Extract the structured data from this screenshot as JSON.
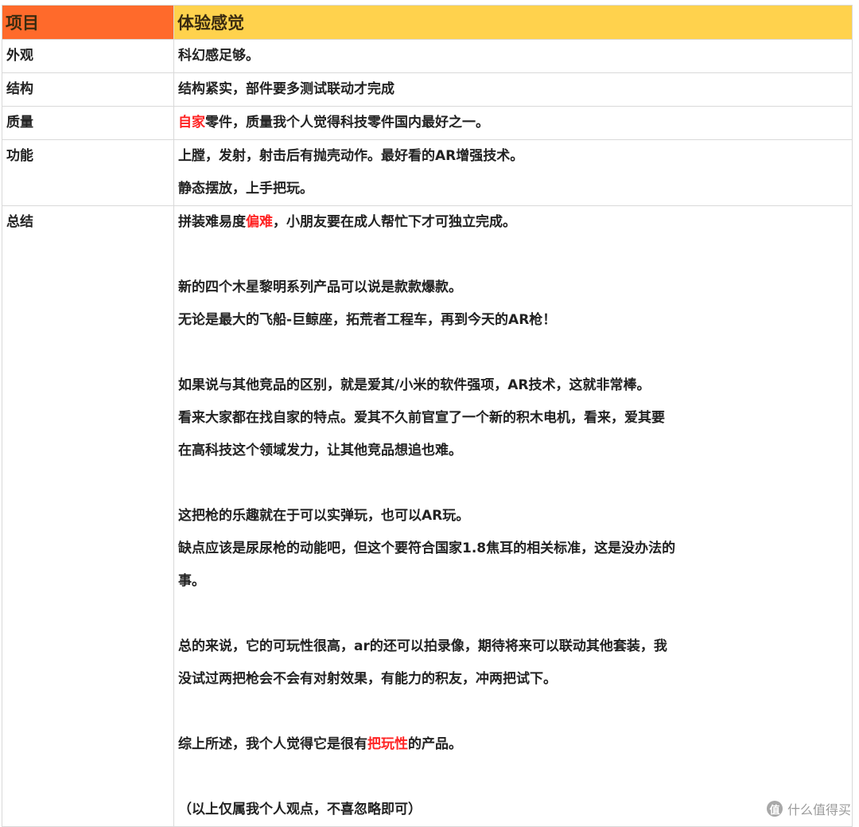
{
  "header": {
    "col1": "项目",
    "col2": "体验感觉",
    "col1_color": "#ff6a2b",
    "col2_color": "#ffd24d"
  },
  "rows": [
    {
      "label": "外观",
      "lines": [
        [
          {
            "t": "科幻感足够。"
          }
        ]
      ]
    },
    {
      "label": "结构",
      "lines": [
        [
          {
            "t": "结构紧实，部件要多测试联动才完成"
          }
        ]
      ]
    },
    {
      "label": "质量",
      "lines": [
        [
          {
            "t": "自家",
            "red": true
          },
          {
            "t": "零件，质量我个人觉得科技零件国内最好之一。"
          }
        ]
      ]
    },
    {
      "label": "功能",
      "lines": [
        [
          {
            "t": "上膛，发射，射击后有抛壳动作。最好看的AR增强技术。"
          }
        ],
        [
          {
            "t": "静态摆放，上手把玩。"
          }
        ]
      ]
    },
    {
      "label": "总结",
      "lines": [
        [
          {
            "t": "拼装难易度"
          },
          {
            "t": "偏难",
            "red": true
          },
          {
            "t": "，小朋友要在成人帮忙下才可独立完成。"
          }
        ],
        [],
        [
          {
            "t": "新的四个木星黎明系列产品可以说是款款爆款。"
          }
        ],
        [
          {
            "t": "无论是最大的飞船-巨鲸座，拓荒者工程车，再到今天的AR枪！"
          }
        ],
        [],
        [
          {
            "t": "如果说与其他竞品的区别，就是爱其/小米的软件强项，AR技术，这就非常棒。"
          }
        ],
        [
          {
            "t": "看来大家都在找自家的特点。爱其不久前官宣了一个新的积木电机，看来，爱其要"
          }
        ],
        [
          {
            "t": "在高科技这个领域发力，让其他竞品想追也难。"
          }
        ],
        [],
        [
          {
            "t": "这把枪的乐趣就在于可以实弹玩，也可以AR玩。"
          }
        ],
        [
          {
            "t": "缺点应该是尿尿枪的动能吧，但这个要符合国家1.8焦耳的相关标准，这是没办法的"
          }
        ],
        [
          {
            "t": "事。"
          }
        ],
        [],
        [
          {
            "t": "总的来说，它的可玩性很高，ar的还可以拍录像，期待将来可以联动其他套装，我"
          }
        ],
        [
          {
            "t": "没试过两把枪会不会有对射效果，有能力的积友，冲两把试下。"
          }
        ],
        [],
        [
          {
            "t": "综上所述，我个人觉得它是很有"
          },
          {
            "t": "把玩性",
            "red": true
          },
          {
            "t": "的产品。"
          }
        ],
        [],
        [
          {
            "t": "（以上仅属我个人观点，不喜忽略即可）"
          }
        ]
      ]
    }
  ],
  "watermark": {
    "logo": "值",
    "text": "什么值得买"
  }
}
